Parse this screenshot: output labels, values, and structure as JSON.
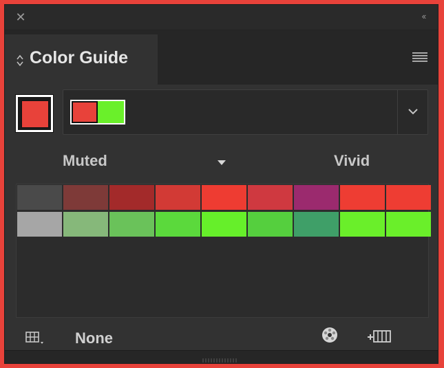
{
  "window": {
    "close_icon": "close-icon",
    "collapse_icon": "double-chevron-left-icon"
  },
  "tab": {
    "label": "Color Guide",
    "arrows_icon": "up-down-arrows-icon",
    "menu_icon": "hamburger-menu-icon"
  },
  "base_color": {
    "color": "#e8423a"
  },
  "harmony": {
    "colors": [
      "#e8423a",
      "#6af02a"
    ],
    "dropdown_icon": "chevron-down-icon"
  },
  "labels": {
    "muted": "Muted",
    "vivid": "Vivid"
  },
  "swatch_grid": {
    "rows": [
      [
        "#4a4a4a",
        "#7e3a38",
        "#a32a2a",
        "#d23a35",
        "#ee3c32",
        "#cf3940",
        "#9b2a6e",
        "#ee3d33",
        "#ee3d33"
      ],
      [
        "#a6a6a6",
        "#86b87a",
        "#6ac25a",
        "#5bd93c",
        "#66ef2a",
        "#55cf3e",
        "#3f9f68",
        "#6aef2a",
        "#6aef2a"
      ]
    ]
  },
  "toolbar": {
    "limit_icon": "swatch-grid-icon",
    "limit_label": "None",
    "edit_colors_icon": "color-wheel-icon",
    "save_group_icon": "save-color-group-icon"
  }
}
